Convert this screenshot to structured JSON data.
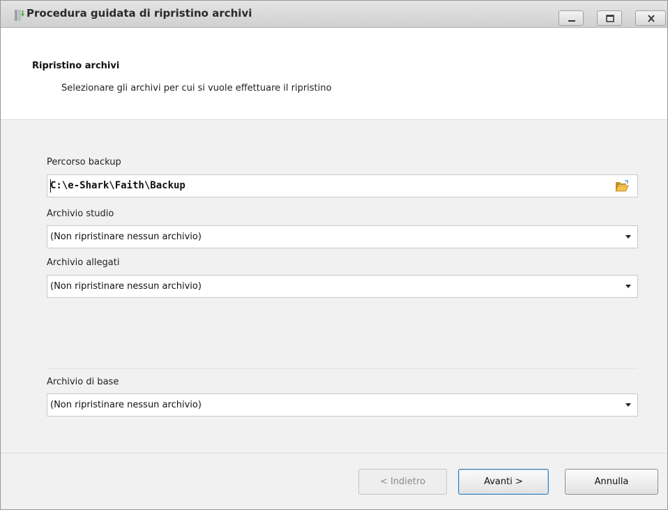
{
  "window": {
    "title": "Procedura guidata di ripristino archivi"
  },
  "header": {
    "title": "Ripristino archivi",
    "subtitle": "Selezionare gli archivi per cui si vuole effettuare il ripristino"
  },
  "form": {
    "backup_path": {
      "label": "Percorso backup",
      "value": "C:\\e-Shark\\Faith\\Backup"
    },
    "studio_archive": {
      "label": "Archivio studio",
      "value": "(Non ripristinare nessun archivio)"
    },
    "attachments_archive": {
      "label": "Archivio allegati",
      "value": "(Non ripristinare nessun archivio)"
    },
    "base_archive": {
      "label": "Archivio di base",
      "value": "(Non ripristinare nessun archivio)"
    }
  },
  "buttons": {
    "back": "< Indietro",
    "next": "Avanti >",
    "cancel": "Annulla"
  },
  "icons": {
    "app": "restore-archive-icon",
    "folder": "open-folder-icon",
    "minimize": "minimize-icon",
    "maximize": "maximize-icon",
    "close": "close-icon",
    "dropdown": "chevron-down-icon"
  },
  "colors": {
    "default_button_border": "#3c7fb1",
    "folder_icon": "#e8b33a"
  }
}
